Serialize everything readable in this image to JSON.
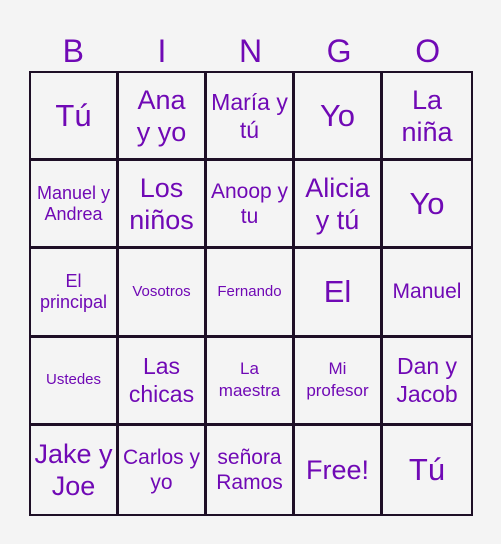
{
  "header": {
    "letters": [
      "B",
      "I",
      "N",
      "G",
      "O"
    ]
  },
  "board": {
    "rows": [
      [
        "Tú",
        "Ana y yo",
        "María y tú",
        "Yo",
        "La niña"
      ],
      [
        "Manuel y Andrea",
        "Los niños",
        "Anoop y tu",
        "Alicia y tú",
        "Yo"
      ],
      [
        "El principal",
        "Vosotros",
        "Fernando",
        "El",
        "Manuel"
      ],
      [
        "Ustedes",
        "Las chicas",
        "La maestra",
        "Mi profesor",
        "Dan y Jacob"
      ],
      [
        "Jake y Joe",
        "Carlos y yo",
        "señora Ramos",
        "Free!",
        "Tú"
      ]
    ]
  },
  "colors": {
    "text": "#7009b5",
    "grid": "#1e0f26",
    "background": "#f4f4f4"
  }
}
